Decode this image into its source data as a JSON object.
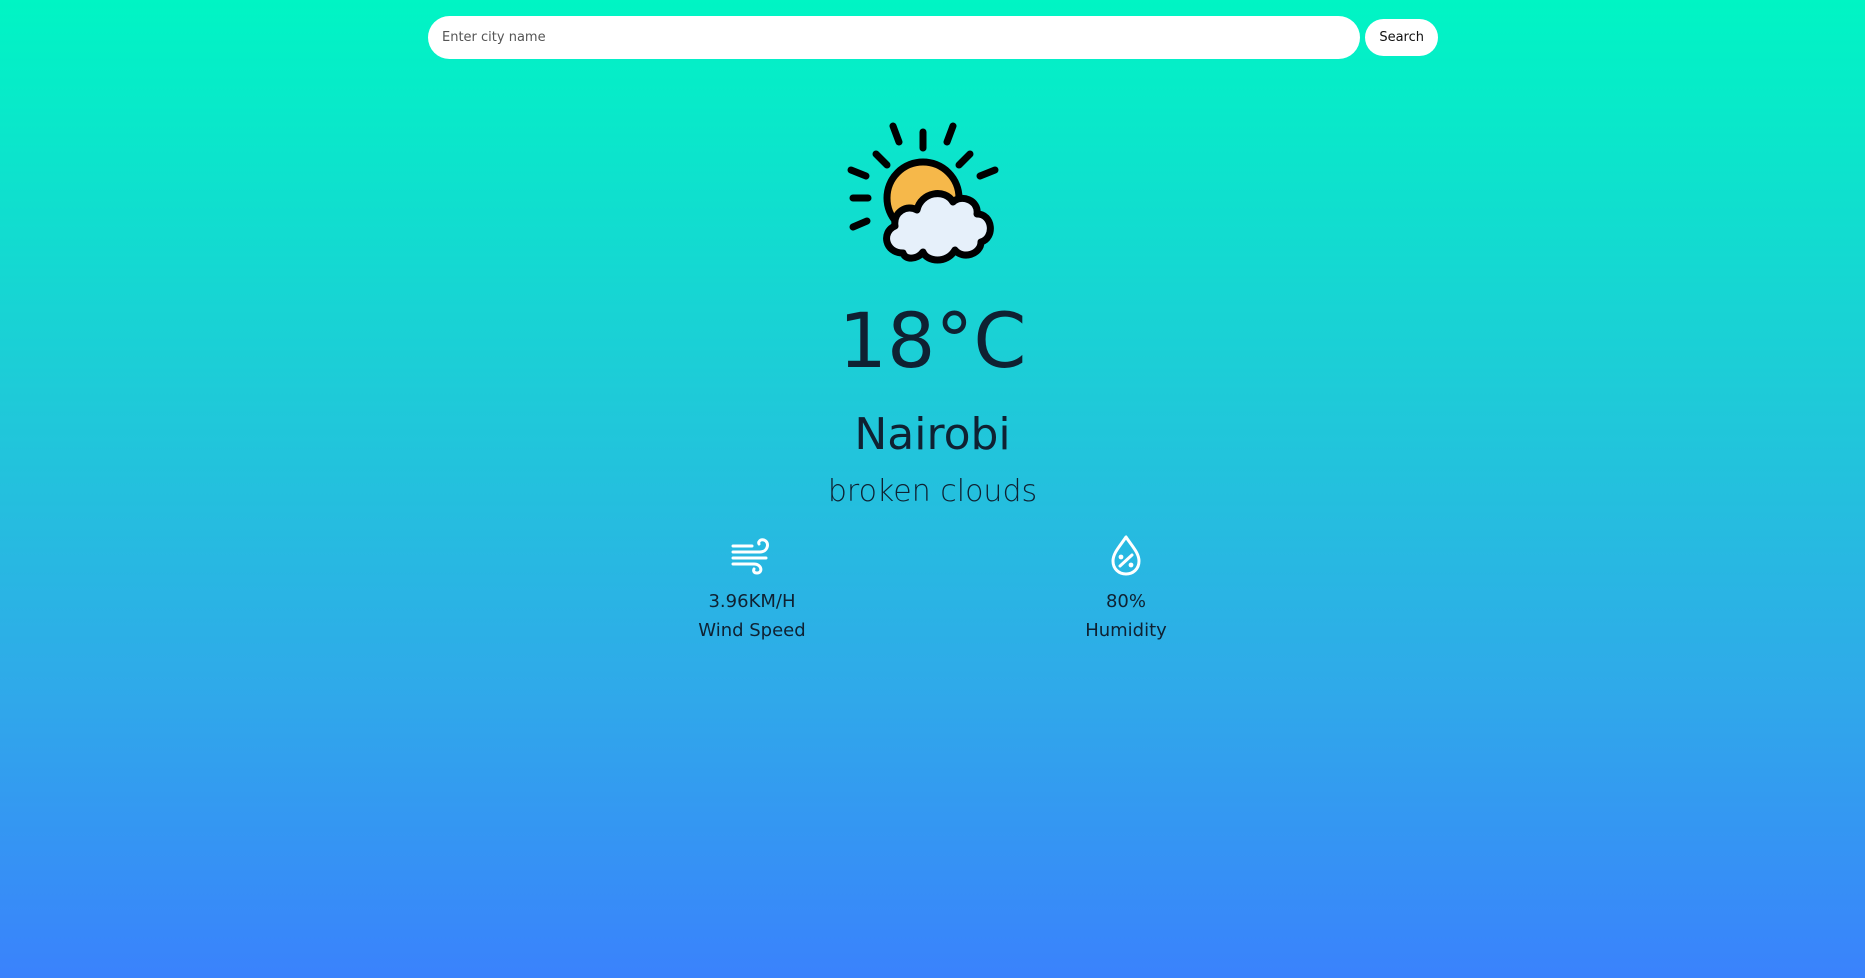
{
  "search": {
    "placeholder": "Enter city name",
    "value": "",
    "button_label": "Search"
  },
  "weather": {
    "icon": "sun-behind-cloud-icon",
    "temperature": "18°C",
    "city": "Nairobi",
    "description": "broken clouds"
  },
  "stats": {
    "wind": {
      "icon": "wind-icon",
      "value": "3.96KM/H",
      "label": "Wind Speed"
    },
    "humidity": {
      "icon": "humidity-drop-icon",
      "value": "80%",
      "label": "Humidity"
    }
  },
  "colors": {
    "gradient_top": "#00f5c4",
    "gradient_bottom": "#3a82fc",
    "text": "#0f2132",
    "sun": "#f6b84a",
    "cloud": "#e6f0fa"
  }
}
